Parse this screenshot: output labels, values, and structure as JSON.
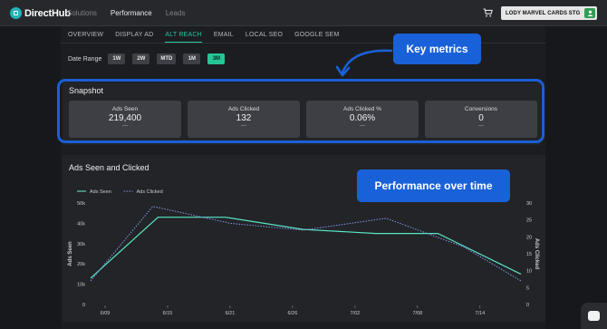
{
  "app": {
    "brand_name": "DirectHub",
    "account_name": "LODY MARVEL CARDS STG"
  },
  "top_nav": [
    {
      "label": "Solutions",
      "active": false
    },
    {
      "label": "Performance",
      "active": true
    },
    {
      "label": "Leads",
      "active": false
    }
  ],
  "sub_nav": [
    {
      "label": "OVERVIEW",
      "active": false
    },
    {
      "label": "DISPLAY AD",
      "active": false
    },
    {
      "label": "ALT REACH",
      "active": true
    },
    {
      "label": "EMAIL",
      "active": false
    },
    {
      "label": "LOCAL SEO",
      "active": false
    },
    {
      "label": "GOOGLE SEM",
      "active": false
    }
  ],
  "date_range": {
    "label": "Date Range",
    "options": [
      {
        "label": "1W",
        "active": false
      },
      {
        "label": "2W",
        "active": false
      },
      {
        "label": "MTD",
        "active": false
      },
      {
        "label": "1M",
        "active": false
      },
      {
        "label": "3M",
        "active": true
      }
    ]
  },
  "snapshot": {
    "title": "Snapshot",
    "metrics": [
      {
        "label": "Ads Seen",
        "value": "219,400",
        "change": "—"
      },
      {
        "label": "Ads Clicked",
        "value": "132",
        "change": "—"
      },
      {
        "label": "Ads Clicked %",
        "value": "0.06%",
        "change": "—"
      },
      {
        "label": "Conversions",
        "value": "0",
        "change": "—"
      }
    ]
  },
  "chart_panel": {
    "title": "Ads Seen and Clicked"
  },
  "callouts": {
    "key_metrics": "Key metrics",
    "performance": "Performance over time"
  },
  "colors": {
    "accent": "#25c597",
    "callout_blue": "#1961d8",
    "series_ads_seen": "#58e6c4",
    "series_ads_clicked": "#7f97e6"
  },
  "chart_data": {
    "type": "line",
    "title": "Ads Seen and Clicked",
    "x_ticks": [
      "6/09",
      "6/15",
      "6/21",
      "6/26",
      "7/02",
      "7/08",
      "7/14"
    ],
    "ylabel": "Ads Seen",
    "y2label": "Ads Clicked",
    "ylim": [
      0,
      50000
    ],
    "y2lim": [
      0,
      30
    ],
    "y_ticks": [
      "0",
      "10k",
      "20k",
      "30k",
      "40k",
      "50k"
    ],
    "y2_ticks": [
      "0",
      "5",
      "10",
      "15",
      "20",
      "25",
      "30"
    ],
    "legend_position": "top-left",
    "grid": false,
    "series": [
      {
        "name": "Ads Seen",
        "axis": "left",
        "style": "solid",
        "points": [
          [
            0,
            13000
          ],
          [
            1.3,
            43000
          ],
          [
            2.6,
            43000
          ],
          [
            4.1,
            37000
          ],
          [
            5.5,
            35000
          ],
          [
            6.7,
            35000
          ],
          [
            8.3,
            15000
          ]
        ]
      },
      {
        "name": "Ads Clicked",
        "axis": "right",
        "style": "dotted",
        "points": [
          [
            0,
            7
          ],
          [
            1.2,
            29
          ],
          [
            2.7,
            24
          ],
          [
            4.1,
            22
          ],
          [
            5.7,
            25.5
          ],
          [
            7.2,
            17
          ],
          [
            8.3,
            7
          ]
        ]
      }
    ]
  }
}
